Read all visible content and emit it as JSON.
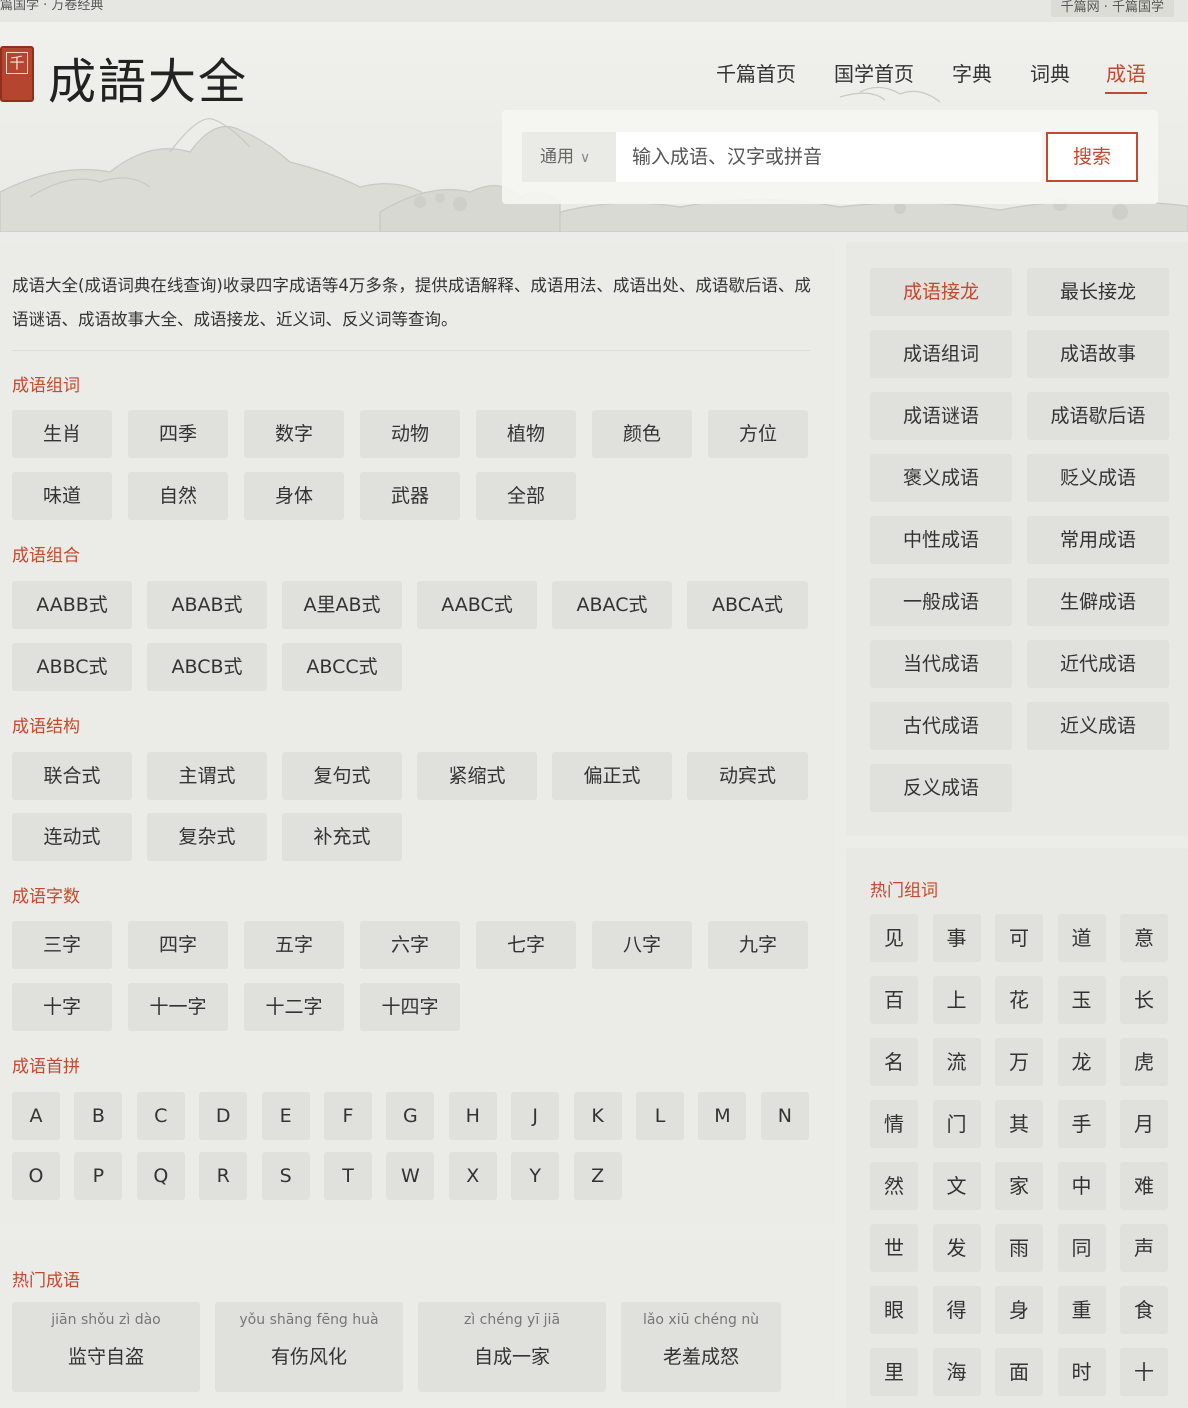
{
  "topbar": {
    "left": "篇国学 · 万卷经典",
    "right": "千篇网 · 千篇国学"
  },
  "logo": {
    "seal": "千",
    "title": "成語大全"
  },
  "nav": [
    "千篇首页",
    "国学首页",
    "字典",
    "词典",
    "成语"
  ],
  "search": {
    "scope": "通用",
    "placeholder": "输入成语、汉字或拼音",
    "button": "搜索"
  },
  "intro": "成语大全(成语词典在线查询)收录四字成语等4万多条，提供成语解释、成语用法、成语出处、成语歇后语、成语谜语、成语故事大全、成语接龙、近义词、反义词等查询。",
  "sections": {
    "zuci": {
      "title": "成语组词",
      "items": [
        "生肖",
        "四季",
        "数字",
        "动物",
        "植物",
        "颜色",
        "方位",
        "味道",
        "自然",
        "身体",
        "武器",
        "全部"
      ]
    },
    "zuhe": {
      "title": "成语组合",
      "items": [
        "AABB式",
        "ABAB式",
        "A里AB式",
        "AABC式",
        "ABAC式",
        "ABCA式",
        "ABBC式",
        "ABCB式",
        "ABCC式"
      ]
    },
    "jiegou": {
      "title": "成语结构",
      "items": [
        "联合式",
        "主谓式",
        "复句式",
        "紧缩式",
        "偏正式",
        "动宾式",
        "连动式",
        "复杂式",
        "补充式"
      ]
    },
    "zishu": {
      "title": "成语字数",
      "items": [
        "三字",
        "四字",
        "五字",
        "六字",
        "七字",
        "八字",
        "九字",
        "十字",
        "十一字",
        "十二字",
        "十四字"
      ]
    },
    "shoupin": {
      "title": "成语首拼",
      "items": [
        "A",
        "B",
        "C",
        "D",
        "E",
        "F",
        "G",
        "H",
        "J",
        "K",
        "L",
        "M",
        "N",
        "O",
        "P",
        "Q",
        "R",
        "S",
        "T",
        "W",
        "X",
        "Y",
        "Z"
      ]
    }
  },
  "popular": {
    "title": "热门成语",
    "items": [
      {
        "pinyin": "jiān shǒu zì dào",
        "word": "监守自盗"
      },
      {
        "pinyin": "yǒu shāng fēng huà",
        "word": "有伤风化"
      },
      {
        "pinyin": "zì chéng yī jiā",
        "word": "自成一家"
      },
      {
        "pinyin": "lǎo xiū chéng nù",
        "word": "老羞成怒"
      }
    ]
  },
  "sidebar": {
    "links": [
      "成语接龙",
      "最长接龙",
      "成语组词",
      "成语故事",
      "成语谜语",
      "成语歇后语",
      "褒义成语",
      "贬义成语",
      "中性成语",
      "常用成语",
      "一般成语",
      "生僻成语",
      "当代成语",
      "近代成语",
      "古代成语",
      "近义成语",
      "反义成语"
    ],
    "highlight_color": "#c24a2f"
  },
  "hot_words": {
    "title": "热门组词",
    "items": [
      "见",
      "事",
      "可",
      "道",
      "意",
      "百",
      "上",
      "花",
      "玉",
      "长",
      "名",
      "流",
      "万",
      "龙",
      "虎",
      "情",
      "门",
      "其",
      "手",
      "月",
      "然",
      "文",
      "家",
      "中",
      "难",
      "世",
      "发",
      "雨",
      "同",
      "声",
      "眼",
      "得",
      "身",
      "重",
      "食",
      "里",
      "海",
      "面",
      "时",
      "十"
    ]
  }
}
